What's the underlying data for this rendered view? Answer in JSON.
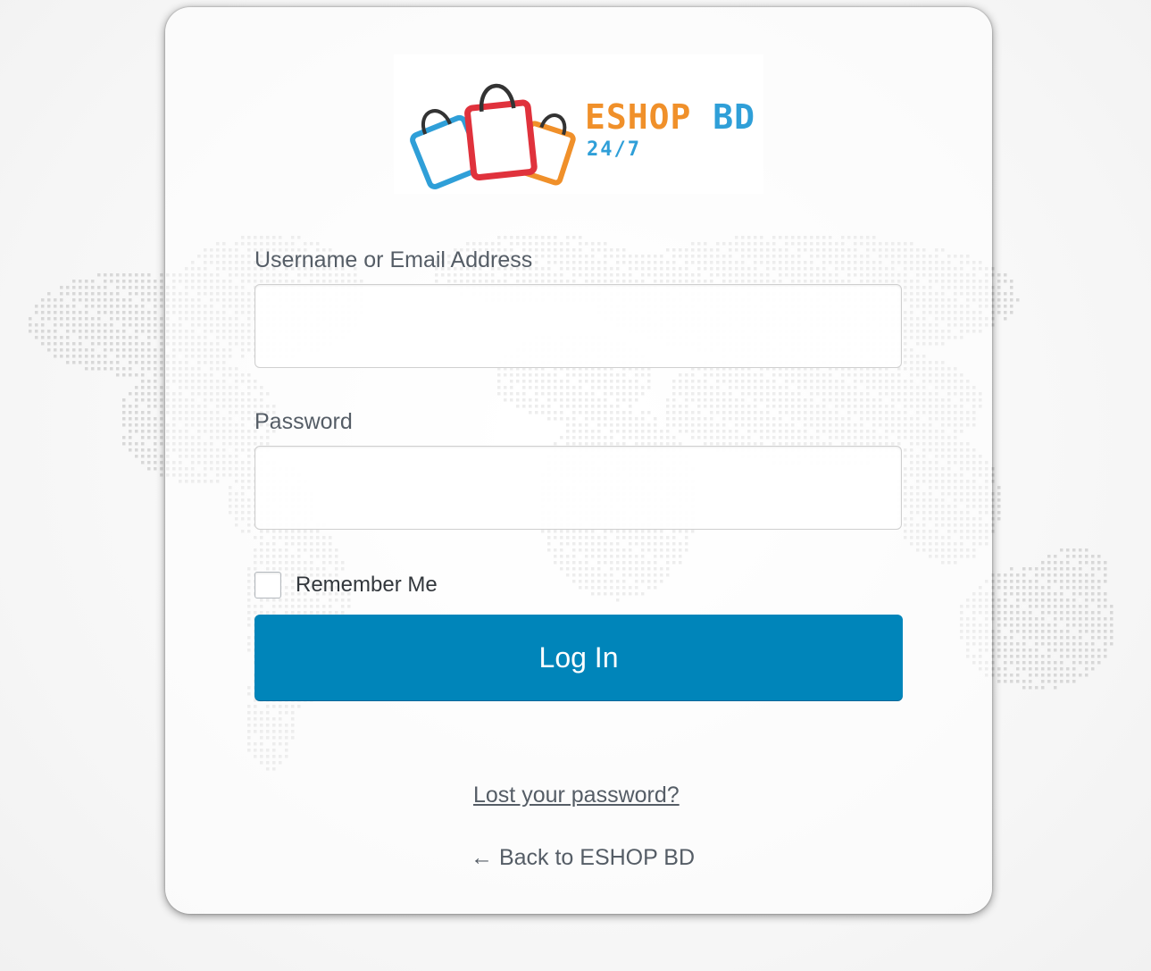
{
  "brand": {
    "logo_title_part1": "ESHOP",
    "logo_title_part2": "BD",
    "logo_subtitle": "24/7",
    "colors": {
      "orange": "#f0902a",
      "blue": "#2f9fd8",
      "red": "#e0323c"
    }
  },
  "form": {
    "username_label": "Username or Email Address",
    "username_value": "",
    "password_label": "Password",
    "password_value": "",
    "remember_label": "Remember Me",
    "remember_checked": false,
    "submit_label": "Log In"
  },
  "links": {
    "lost_password": "Lost your password?",
    "back_to_site": "← Back to ESHOP BD"
  },
  "theme": {
    "button_color": "#0085ba",
    "label_color": "#555d66"
  }
}
